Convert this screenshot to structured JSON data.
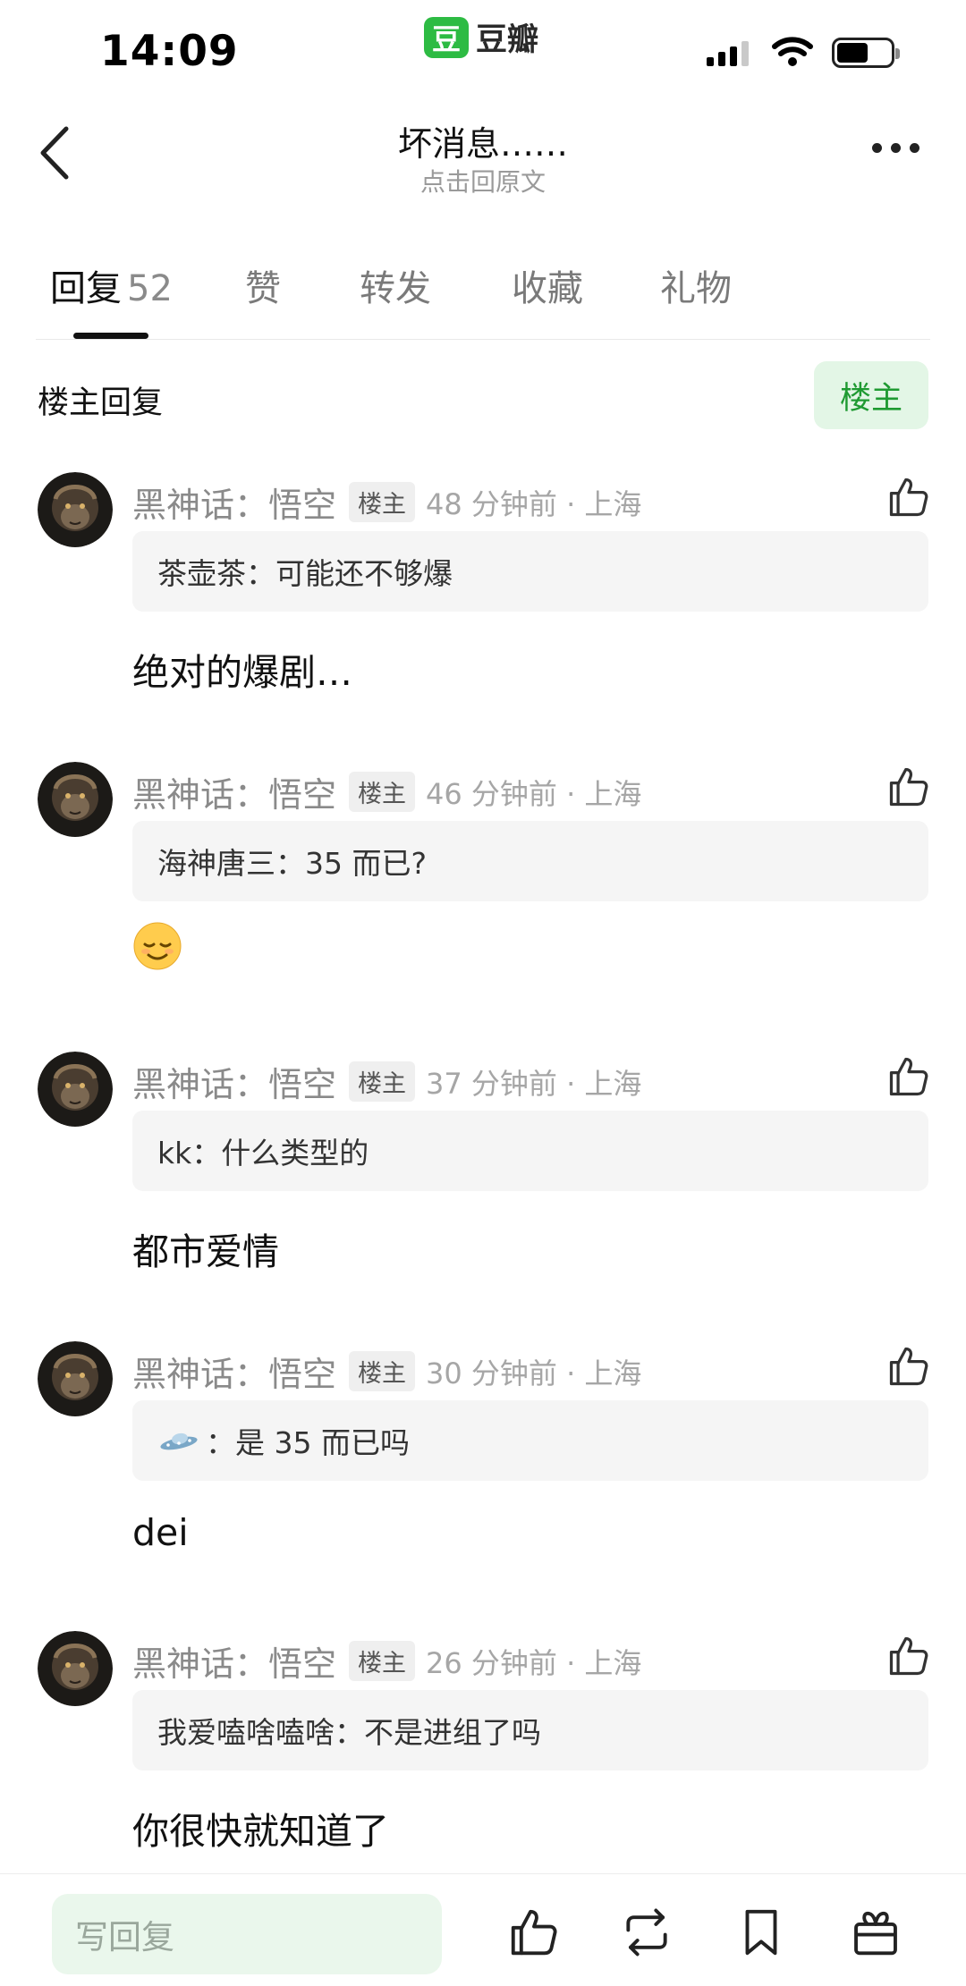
{
  "status_bar": {
    "time": "14:09",
    "app_logo_char": "豆",
    "app_name": "豆瓣"
  },
  "header": {
    "title": "坏消息……",
    "subtitle": "点击回原文"
  },
  "tabs": [
    {
      "label": "回复",
      "count": "52",
      "active": true
    },
    {
      "label": "赞"
    },
    {
      "label": "转发"
    },
    {
      "label": "收藏"
    },
    {
      "label": "礼物"
    }
  ],
  "section": {
    "title": "楼主回复",
    "owner_button": "楼主"
  },
  "comments": [
    {
      "author": "黑神话：悟空",
      "tag": "楼主",
      "time_loc": "48 分钟前 · 上海",
      "quote_name": "茶壶茶：",
      "quote_text": "可能还不够爆",
      "reply": "绝对的爆剧…"
    },
    {
      "author": "黑神话：悟空",
      "tag": "楼主",
      "time_loc": "46 分钟前 · 上海",
      "quote_name": "海神唐三：",
      "quote_text": "35 而已?",
      "reply_emoji": "relieved-face-emoji"
    },
    {
      "author": "黑神话：悟空",
      "tag": "楼主",
      "time_loc": "37 分钟前 · 上海",
      "quote_name": "kk：",
      "quote_text": "什么类型的",
      "reply": "都市爱情"
    },
    {
      "author": "黑神话：悟空",
      "tag": "楼主",
      "time_loc": "30 分钟前 · 上海",
      "quote_name": "：",
      "quote_icon": "ufo-icon",
      "quote_text": "是 35 而已吗",
      "reply": "dei"
    },
    {
      "author": "黑神话：悟空",
      "tag": "楼主",
      "time_loc": "26 分钟前 · 上海",
      "quote_name": "我爱嗑啥嗑啥：",
      "quote_text": "不是进组了吗",
      "reply": "你很快就知道了"
    }
  ],
  "bottom_bar": {
    "placeholder": "写回复",
    "icons": [
      "thumbs-up-icon",
      "repost-icon",
      "bookmark-icon",
      "gift-icon"
    ]
  },
  "colors": {
    "brand_green": "#2dbb43",
    "owner_btn_bg": "#e3f6e6",
    "owner_btn_text": "#1f9a32"
  }
}
